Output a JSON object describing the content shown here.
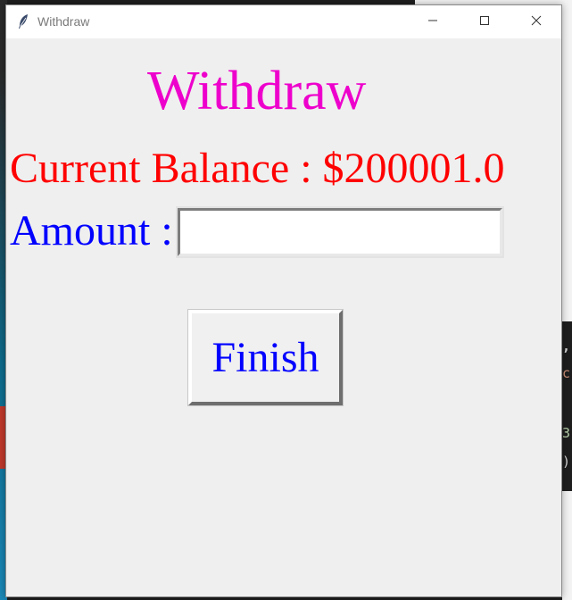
{
  "window": {
    "title": "Withdraw",
    "app_icon": "feather-icon",
    "controls": {
      "minimize": "minimize-icon",
      "maximize": "maximize-icon",
      "close": "close-icon"
    }
  },
  "form": {
    "heading": "Withdraw",
    "balance_text": "Current Balance : $200001.0",
    "amount_label": "Amount :",
    "amount_value": "",
    "finish_label": "Finish"
  },
  "background_code": {
    "line1": ",",
    "line2": "c",
    "line3": "3",
    "line4": ")"
  },
  "colors": {
    "heading": "#ee00cc",
    "balance": "#ff0000",
    "amount_label": "#0000ff",
    "finish_text": "#0000ff",
    "window_bg": "#efefef"
  }
}
